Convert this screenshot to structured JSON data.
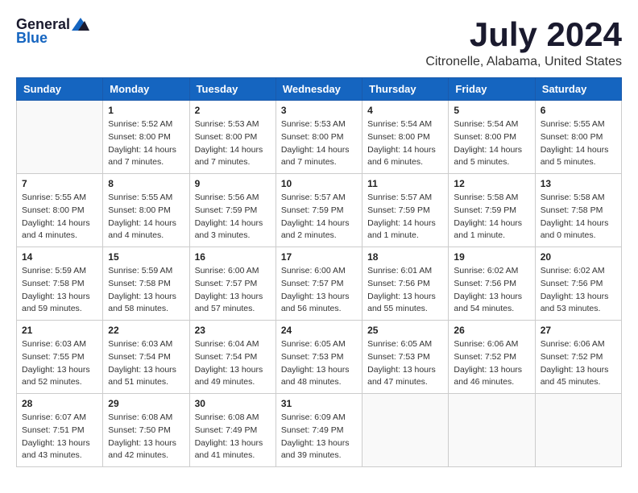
{
  "header": {
    "logo_general": "General",
    "logo_blue": "Blue",
    "title": "July 2024",
    "subtitle": "Citronelle, Alabama, United States"
  },
  "calendar": {
    "days_of_week": [
      "Sunday",
      "Monday",
      "Tuesday",
      "Wednesday",
      "Thursday",
      "Friday",
      "Saturday"
    ],
    "weeks": [
      [
        {
          "day": "",
          "empty": true
        },
        {
          "day": "1",
          "sunrise": "Sunrise: 5:52 AM",
          "sunset": "Sunset: 8:00 PM",
          "daylight": "Daylight: 14 hours and 7 minutes."
        },
        {
          "day": "2",
          "sunrise": "Sunrise: 5:53 AM",
          "sunset": "Sunset: 8:00 PM",
          "daylight": "Daylight: 14 hours and 7 minutes."
        },
        {
          "day": "3",
          "sunrise": "Sunrise: 5:53 AM",
          "sunset": "Sunset: 8:00 PM",
          "daylight": "Daylight: 14 hours and 7 minutes."
        },
        {
          "day": "4",
          "sunrise": "Sunrise: 5:54 AM",
          "sunset": "Sunset: 8:00 PM",
          "daylight": "Daylight: 14 hours and 6 minutes."
        },
        {
          "day": "5",
          "sunrise": "Sunrise: 5:54 AM",
          "sunset": "Sunset: 8:00 PM",
          "daylight": "Daylight: 14 hours and 5 minutes."
        },
        {
          "day": "6",
          "sunrise": "Sunrise: 5:55 AM",
          "sunset": "Sunset: 8:00 PM",
          "daylight": "Daylight: 14 hours and 5 minutes."
        }
      ],
      [
        {
          "day": "7",
          "sunrise": "Sunrise: 5:55 AM",
          "sunset": "Sunset: 8:00 PM",
          "daylight": "Daylight: 14 hours and 4 minutes."
        },
        {
          "day": "8",
          "sunrise": "Sunrise: 5:55 AM",
          "sunset": "Sunset: 8:00 PM",
          "daylight": "Daylight: 14 hours and 4 minutes."
        },
        {
          "day": "9",
          "sunrise": "Sunrise: 5:56 AM",
          "sunset": "Sunset: 7:59 PM",
          "daylight": "Daylight: 14 hours and 3 minutes."
        },
        {
          "day": "10",
          "sunrise": "Sunrise: 5:57 AM",
          "sunset": "Sunset: 7:59 PM",
          "daylight": "Daylight: 14 hours and 2 minutes."
        },
        {
          "day": "11",
          "sunrise": "Sunrise: 5:57 AM",
          "sunset": "Sunset: 7:59 PM",
          "daylight": "Daylight: 14 hours and 1 minute."
        },
        {
          "day": "12",
          "sunrise": "Sunrise: 5:58 AM",
          "sunset": "Sunset: 7:59 PM",
          "daylight": "Daylight: 14 hours and 1 minute."
        },
        {
          "day": "13",
          "sunrise": "Sunrise: 5:58 AM",
          "sunset": "Sunset: 7:58 PM",
          "daylight": "Daylight: 14 hours and 0 minutes."
        }
      ],
      [
        {
          "day": "14",
          "sunrise": "Sunrise: 5:59 AM",
          "sunset": "Sunset: 7:58 PM",
          "daylight": "Daylight: 13 hours and 59 minutes."
        },
        {
          "day": "15",
          "sunrise": "Sunrise: 5:59 AM",
          "sunset": "Sunset: 7:58 PM",
          "daylight": "Daylight: 13 hours and 58 minutes."
        },
        {
          "day": "16",
          "sunrise": "Sunrise: 6:00 AM",
          "sunset": "Sunset: 7:57 PM",
          "daylight": "Daylight: 13 hours and 57 minutes."
        },
        {
          "day": "17",
          "sunrise": "Sunrise: 6:00 AM",
          "sunset": "Sunset: 7:57 PM",
          "daylight": "Daylight: 13 hours and 56 minutes."
        },
        {
          "day": "18",
          "sunrise": "Sunrise: 6:01 AM",
          "sunset": "Sunset: 7:56 PM",
          "daylight": "Daylight: 13 hours and 55 minutes."
        },
        {
          "day": "19",
          "sunrise": "Sunrise: 6:02 AM",
          "sunset": "Sunset: 7:56 PM",
          "daylight": "Daylight: 13 hours and 54 minutes."
        },
        {
          "day": "20",
          "sunrise": "Sunrise: 6:02 AM",
          "sunset": "Sunset: 7:56 PM",
          "daylight": "Daylight: 13 hours and 53 minutes."
        }
      ],
      [
        {
          "day": "21",
          "sunrise": "Sunrise: 6:03 AM",
          "sunset": "Sunset: 7:55 PM",
          "daylight": "Daylight: 13 hours and 52 minutes."
        },
        {
          "day": "22",
          "sunrise": "Sunrise: 6:03 AM",
          "sunset": "Sunset: 7:54 PM",
          "daylight": "Daylight: 13 hours and 51 minutes."
        },
        {
          "day": "23",
          "sunrise": "Sunrise: 6:04 AM",
          "sunset": "Sunset: 7:54 PM",
          "daylight": "Daylight: 13 hours and 49 minutes."
        },
        {
          "day": "24",
          "sunrise": "Sunrise: 6:05 AM",
          "sunset": "Sunset: 7:53 PM",
          "daylight": "Daylight: 13 hours and 48 minutes."
        },
        {
          "day": "25",
          "sunrise": "Sunrise: 6:05 AM",
          "sunset": "Sunset: 7:53 PM",
          "daylight": "Daylight: 13 hours and 47 minutes."
        },
        {
          "day": "26",
          "sunrise": "Sunrise: 6:06 AM",
          "sunset": "Sunset: 7:52 PM",
          "daylight": "Daylight: 13 hours and 46 minutes."
        },
        {
          "day": "27",
          "sunrise": "Sunrise: 6:06 AM",
          "sunset": "Sunset: 7:52 PM",
          "daylight": "Daylight: 13 hours and 45 minutes."
        }
      ],
      [
        {
          "day": "28",
          "sunrise": "Sunrise: 6:07 AM",
          "sunset": "Sunset: 7:51 PM",
          "daylight": "Daylight: 13 hours and 43 minutes."
        },
        {
          "day": "29",
          "sunrise": "Sunrise: 6:08 AM",
          "sunset": "Sunset: 7:50 PM",
          "daylight": "Daylight: 13 hours and 42 minutes."
        },
        {
          "day": "30",
          "sunrise": "Sunrise: 6:08 AM",
          "sunset": "Sunset: 7:49 PM",
          "daylight": "Daylight: 13 hours and 41 minutes."
        },
        {
          "day": "31",
          "sunrise": "Sunrise: 6:09 AM",
          "sunset": "Sunset: 7:49 PM",
          "daylight": "Daylight: 13 hours and 39 minutes."
        },
        {
          "day": "",
          "empty": true
        },
        {
          "day": "",
          "empty": true
        },
        {
          "day": "",
          "empty": true
        }
      ]
    ]
  }
}
